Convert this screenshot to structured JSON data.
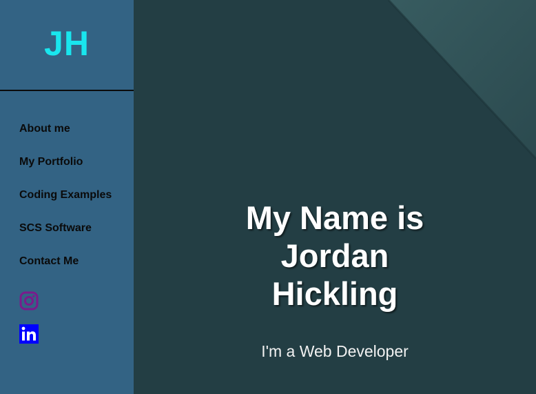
{
  "sidebar": {
    "logo": "JH",
    "nav_items": [
      {
        "label": "About me"
      },
      {
        "label": "My Portfolio"
      },
      {
        "label": "Coding Examples"
      },
      {
        "label": "SCS Software"
      },
      {
        "label": "Contact Me"
      }
    ],
    "social": [
      {
        "icon": "instagram-icon"
      },
      {
        "icon": "linkedin-icon"
      }
    ]
  },
  "hero": {
    "title": "My Name is Jordan Hickling",
    "subtitle": "I'm a Web Developer"
  },
  "colors": {
    "sidebar_bg": "#336384",
    "logo": "#19e6ee",
    "hero_bg": "#233e44",
    "instagram": "#7a1b8c",
    "linkedin": "#0000ff"
  }
}
